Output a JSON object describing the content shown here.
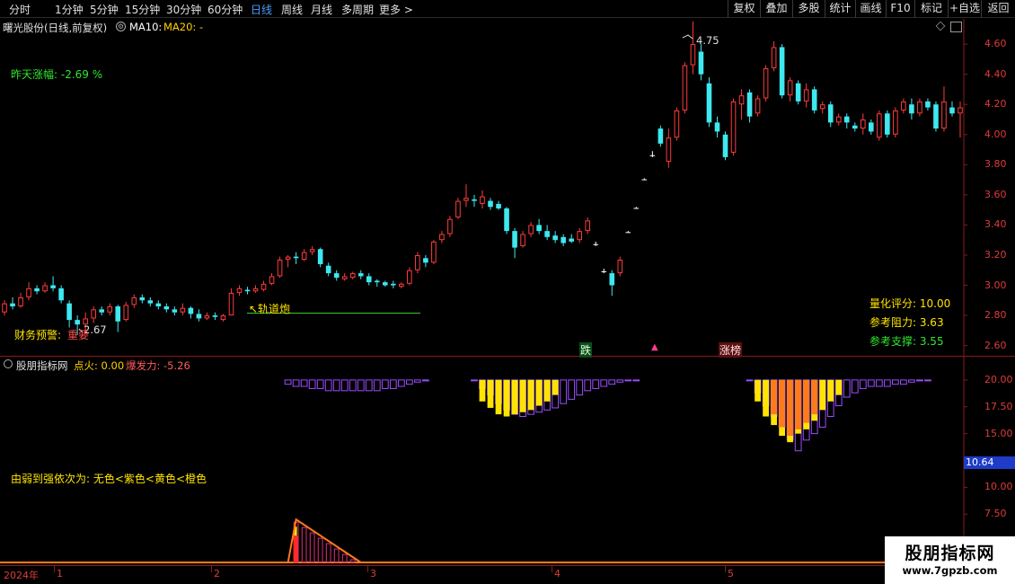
{
  "toolbar": {
    "left": [
      "分时",
      "1分钟",
      "5分钟",
      "15分钟",
      "30分钟",
      "60分钟",
      "日线",
      "周线",
      "月线",
      "多周期",
      "更多 >"
    ],
    "active": "日线",
    "right": [
      "复权",
      "叠加",
      "多股",
      "统计",
      "画线",
      "F10",
      "标记",
      "+自选",
      "返回"
    ]
  },
  "main": {
    "title": "曙光股份(日线,前复权)",
    "ma10": "MA10:",
    "ma20": "MA20: -",
    "yesterday_change_label": "昨天涨幅: -2.69 %",
    "high_label": "4.75",
    "low_label": "2.67",
    "annotation_track": "↖轨道炮",
    "finance_warning": "财务预警:",
    "finance_tag": "重要",
    "quant_score": "量化评分: 10.00",
    "resistance": "参考阻力: 3.63",
    "support": "参考支撑: 3.55",
    "marker_fall": "跌",
    "marker_up": "▲",
    "marker_limit": "涨榜",
    "y_axis": [
      "4.60",
      "4.40",
      "4.20",
      "4.00",
      "3.80",
      "3.60",
      "3.40",
      "3.20",
      "3.00",
      "2.80",
      "2.60"
    ]
  },
  "indicator": {
    "name": "股朋指标网",
    "ignite": "点火: 0.00",
    "burst": "爆发力: -5.26",
    "legend": "由弱到强依次为: 无色<紫色<黄色<橙色",
    "y_axis": [
      "20.00",
      "17.50",
      "15.00",
      "12.50",
      "10.00",
      "7.50",
      "5.00"
    ],
    "current_value": "10.64"
  },
  "dates": {
    "year": "2024年",
    "months": [
      "1",
      "2",
      "3",
      "4",
      "5"
    ]
  },
  "watermark": {
    "title": "股朋指标网",
    "url": "www.7gpzb.com"
  },
  "colors": {
    "up": "#ff3b3b",
    "down": "#3ee8f0",
    "axis": "#e03a3a",
    "active_tab": "#4b9bff",
    "purple": "#9a4dff",
    "yellow": "#ffe400",
    "orange": "#ff7a1a",
    "green_line": "#2ecc2e"
  },
  "chart_data": {
    "type": "candlestick",
    "ylim": [
      2.55,
      4.72
    ],
    "candles": [
      {
        "o": 2.82,
        "c": 2.88,
        "h": 2.9,
        "l": 2.8
      },
      {
        "o": 2.88,
        "c": 2.86,
        "h": 2.92,
        "l": 2.84
      },
      {
        "o": 2.86,
        "c": 2.92,
        "h": 2.95,
        "l": 2.85
      },
      {
        "o": 2.92,
        "c": 2.98,
        "h": 3.02,
        "l": 2.9
      },
      {
        "o": 2.98,
        "c": 2.96,
        "h": 3.0,
        "l": 2.94
      },
      {
        "o": 2.96,
        "c": 3.0,
        "h": 3.02,
        "l": 2.95
      },
      {
        "o": 3.0,
        "c": 2.98,
        "h": 3.06,
        "l": 2.96
      },
      {
        "o": 2.98,
        "c": 2.9,
        "h": 3.0,
        "l": 2.88
      },
      {
        "o": 2.88,
        "c": 2.77,
        "h": 2.9,
        "l": 2.72
      },
      {
        "o": 2.77,
        "c": 2.74,
        "h": 2.8,
        "l": 2.67
      },
      {
        "o": 2.74,
        "c": 2.78,
        "h": 2.82,
        "l": 2.7
      },
      {
        "o": 2.78,
        "c": 2.84,
        "h": 2.86,
        "l": 2.75
      },
      {
        "o": 2.84,
        "c": 2.82,
        "h": 2.86,
        "l": 2.8
      },
      {
        "o": 2.82,
        "c": 2.86,
        "h": 2.88,
        "l": 2.8
      },
      {
        "o": 2.86,
        "c": 2.76,
        "h": 2.87,
        "l": 2.69
      },
      {
        "o": 2.77,
        "c": 2.87,
        "h": 2.89,
        "l": 2.76
      },
      {
        "o": 2.87,
        "c": 2.92,
        "h": 2.94,
        "l": 2.85
      },
      {
        "o": 2.92,
        "c": 2.9,
        "h": 2.94,
        "l": 2.88
      },
      {
        "o": 2.9,
        "c": 2.88,
        "h": 2.92,
        "l": 2.86
      },
      {
        "o": 2.88,
        "c": 2.86,
        "h": 2.9,
        "l": 2.84
      },
      {
        "o": 2.86,
        "c": 2.84,
        "h": 2.88,
        "l": 2.82
      },
      {
        "o": 2.84,
        "c": 2.82,
        "h": 2.86,
        "l": 2.8
      },
      {
        "o": 2.82,
        "c": 2.85,
        "h": 2.88,
        "l": 2.8
      },
      {
        "o": 2.85,
        "c": 2.81,
        "h": 2.86,
        "l": 2.78
      },
      {
        "o": 2.81,
        "c": 2.78,
        "h": 2.84,
        "l": 2.76
      },
      {
        "o": 2.78,
        "c": 2.8,
        "h": 2.82,
        "l": 2.77
      },
      {
        "o": 2.8,
        "c": 2.79,
        "h": 2.82,
        "l": 2.77
      },
      {
        "o": 2.77,
        "c": 2.8,
        "h": 2.81,
        "l": 2.76
      },
      {
        "o": 2.8,
        "c": 2.95,
        "h": 2.98,
        "l": 2.8
      },
      {
        "o": 2.95,
        "c": 2.98,
        "h": 3.0,
        "l": 2.93
      },
      {
        "o": 2.97,
        "c": 2.96,
        "h": 2.99,
        "l": 2.94
      },
      {
        "o": 2.96,
        "c": 2.98,
        "h": 3.0,
        "l": 2.95
      },
      {
        "o": 2.97,
        "c": 3.01,
        "h": 3.03,
        "l": 2.96
      },
      {
        "o": 3.01,
        "c": 3.06,
        "h": 3.08,
        "l": 3.0
      },
      {
        "o": 3.06,
        "c": 3.17,
        "h": 3.19,
        "l": 3.05
      },
      {
        "o": 3.17,
        "c": 3.19,
        "h": 3.2,
        "l": 3.12
      },
      {
        "o": 3.19,
        "c": 3.18,
        "h": 3.22,
        "l": 3.14
      },
      {
        "o": 3.17,
        "c": 3.22,
        "h": 3.24,
        "l": 3.16
      },
      {
        "o": 3.22,
        "c": 3.24,
        "h": 3.26,
        "l": 3.2
      },
      {
        "o": 3.24,
        "c": 3.14,
        "h": 3.25,
        "l": 3.12
      },
      {
        "o": 3.13,
        "c": 3.08,
        "h": 3.15,
        "l": 3.06
      },
      {
        "o": 3.08,
        "c": 3.05,
        "h": 3.1,
        "l": 3.03
      },
      {
        "o": 3.04,
        "c": 3.06,
        "h": 3.08,
        "l": 3.03
      },
      {
        "o": 3.05,
        "c": 3.08,
        "h": 3.09,
        "l": 3.04
      },
      {
        "o": 3.08,
        "c": 3.06,
        "h": 3.1,
        "l": 3.04
      },
      {
        "o": 3.06,
        "c": 3.02,
        "h": 3.08,
        "l": 3.0
      },
      {
        "o": 3.03,
        "c": 3.02,
        "h": 3.04,
        "l": 2.99
      },
      {
        "o": 3.02,
        "c": 3.0,
        "h": 3.03,
        "l": 2.99
      },
      {
        "o": 3.01,
        "c": 3.0,
        "h": 3.03,
        "l": 2.98
      },
      {
        "o": 2.99,
        "c": 3.01,
        "h": 3.02,
        "l": 2.98
      },
      {
        "o": 3.01,
        "c": 3.1,
        "h": 3.12,
        "l": 3.0
      },
      {
        "o": 3.1,
        "c": 3.2,
        "h": 3.22,
        "l": 3.08
      },
      {
        "o": 3.18,
        "c": 3.15,
        "h": 3.2,
        "l": 3.12
      },
      {
        "o": 3.15,
        "c": 3.29,
        "h": 3.3,
        "l": 3.14
      },
      {
        "o": 3.3,
        "c": 3.34,
        "h": 3.36,
        "l": 3.28
      },
      {
        "o": 3.34,
        "c": 3.44,
        "h": 3.46,
        "l": 3.32
      },
      {
        "o": 3.45,
        "c": 3.56,
        "h": 3.58,
        "l": 3.44
      },
      {
        "o": 3.56,
        "c": 3.58,
        "h": 3.67,
        "l": 3.52
      },
      {
        "o": 3.57,
        "c": 3.56,
        "h": 3.6,
        "l": 3.52
      },
      {
        "o": 3.54,
        "c": 3.59,
        "h": 3.63,
        "l": 3.51
      },
      {
        "o": 3.56,
        "c": 3.52,
        "h": 3.58,
        "l": 3.5
      },
      {
        "o": 3.54,
        "c": 3.51,
        "h": 3.56,
        "l": 3.5
      },
      {
        "o": 3.51,
        "c": 3.36,
        "h": 3.52,
        "l": 3.34
      },
      {
        "o": 3.36,
        "c": 3.25,
        "h": 3.38,
        "l": 3.18
      },
      {
        "o": 3.26,
        "c": 3.34,
        "h": 3.36,
        "l": 3.25
      },
      {
        "o": 3.34,
        "c": 3.4,
        "h": 3.42,
        "l": 3.32
      },
      {
        "o": 3.4,
        "c": 3.36,
        "h": 3.44,
        "l": 3.34
      },
      {
        "o": 3.36,
        "c": 3.32,
        "h": 3.4,
        "l": 3.3
      },
      {
        "o": 3.33,
        "c": 3.3,
        "h": 3.36,
        "l": 3.28
      },
      {
        "o": 3.32,
        "c": 3.28,
        "h": 3.34,
        "l": 3.26
      },
      {
        "o": 3.31,
        "c": 3.29,
        "h": 3.34,
        "l": 3.28
      },
      {
        "o": 3.3,
        "c": 3.36,
        "h": 3.38,
        "l": 3.28
      },
      {
        "o": 3.36,
        "c": 3.43,
        "h": 3.45,
        "l": 3.34
      },
      {
        "o": 3.27,
        "c": 3.27,
        "h": 3.29,
        "l": 3.26
      },
      {
        "o": 3.09,
        "c": 3.09,
        "h": 3.11,
        "l": 3.08
      },
      {
        "o": 3.08,
        "c": 3.0,
        "h": 3.1,
        "l": 2.93
      },
      {
        "o": 3.08,
        "c": 3.17,
        "h": 3.19,
        "l": 3.06
      },
      {
        "o": 3.35,
        "c": 3.35,
        "h": 3.36,
        "l": 3.35
      },
      {
        "o": 3.51,
        "c": 3.51,
        "h": 3.52,
        "l": 3.51
      },
      {
        "o": 3.7,
        "c": 3.7,
        "h": 3.71,
        "l": 3.7
      },
      {
        "o": 3.86,
        "c": 3.86,
        "h": 3.89,
        "l": 3.85
      },
      {
        "o": 4.04,
        "c": 3.94,
        "h": 4.06,
        "l": 3.92
      },
      {
        "o": 3.82,
        "c": 3.98,
        "h": 4.04,
        "l": 3.78
      },
      {
        "o": 3.98,
        "c": 4.16,
        "h": 4.18,
        "l": 3.96
      },
      {
        "o": 4.16,
        "c": 4.46,
        "h": 4.48,
        "l": 4.14
      },
      {
        "o": 4.46,
        "c": 4.6,
        "h": 4.75,
        "l": 4.4
      },
      {
        "o": 4.55,
        "c": 4.4,
        "h": 4.6,
        "l": 4.36
      },
      {
        "o": 4.34,
        "c": 4.08,
        "h": 4.38,
        "l": 4.05
      },
      {
        "o": 4.08,
        "c": 4.02,
        "h": 4.12,
        "l": 3.98
      },
      {
        "o": 4.0,
        "c": 3.85,
        "h": 4.02,
        "l": 3.83
      },
      {
        "o": 3.88,
        "c": 4.22,
        "h": 4.24,
        "l": 3.86
      },
      {
        "o": 4.2,
        "c": 4.26,
        "h": 4.3,
        "l": 4.1
      },
      {
        "o": 4.28,
        "c": 4.12,
        "h": 4.3,
        "l": 4.08
      },
      {
        "o": 4.14,
        "c": 4.24,
        "h": 4.26,
        "l": 4.12
      },
      {
        "o": 4.24,
        "c": 4.44,
        "h": 4.46,
        "l": 4.22
      },
      {
        "o": 4.44,
        "c": 4.58,
        "h": 4.62,
        "l": 4.42
      },
      {
        "o": 4.58,
        "c": 4.26,
        "h": 4.6,
        "l": 4.24
      },
      {
        "o": 4.26,
        "c": 4.36,
        "h": 4.38,
        "l": 4.22
      },
      {
        "o": 4.34,
        "c": 4.22,
        "h": 4.36,
        "l": 4.2
      },
      {
        "o": 4.22,
        "c": 4.3,
        "h": 4.34,
        "l": 4.18
      },
      {
        "o": 4.3,
        "c": 4.16,
        "h": 4.32,
        "l": 4.14
      },
      {
        "o": 4.17,
        "c": 4.2,
        "h": 4.22,
        "l": 4.14
      },
      {
        "o": 4.2,
        "c": 4.08,
        "h": 4.22,
        "l": 4.05
      },
      {
        "o": 4.08,
        "c": 4.12,
        "h": 4.14,
        "l": 4.06
      },
      {
        "o": 4.12,
        "c": 4.08,
        "h": 4.14,
        "l": 4.04
      },
      {
        "o": 4.06,
        "c": 4.04,
        "h": 4.08,
        "l": 4.02
      },
      {
        "o": 4.04,
        "c": 4.1,
        "h": 4.14,
        "l": 4.0
      },
      {
        "o": 4.08,
        "c": 4.02,
        "h": 4.1,
        "l": 4.0
      },
      {
        "o": 3.98,
        "c": 4.14,
        "h": 4.16,
        "l": 3.96
      },
      {
        "o": 4.14,
        "c": 4.0,
        "h": 4.16,
        "l": 3.98
      },
      {
        "o": 4.0,
        "c": 4.16,
        "h": 4.18,
        "l": 3.98
      },
      {
        "o": 4.16,
        "c": 4.22,
        "h": 4.24,
        "l": 4.14
      },
      {
        "o": 4.2,
        "c": 4.14,
        "h": 4.24,
        "l": 4.1
      },
      {
        "o": 4.14,
        "c": 4.22,
        "h": 4.24,
        "l": 4.12
      },
      {
        "o": 4.22,
        "c": 4.18,
        "h": 4.24,
        "l": 4.16
      },
      {
        "o": 4.2,
        "c": 4.04,
        "h": 4.22,
        "l": 4.02
      },
      {
        "o": 4.04,
        "c": 4.22,
        "h": 4.32,
        "l": 4.02
      },
      {
        "o": 4.18,
        "c": 4.14,
        "h": 4.22,
        "l": 4.12
      },
      {
        "o": 4.14,
        "c": 4.18,
        "h": 4.22,
        "l": 3.98
      }
    ],
    "indicator_ylim": [
      3.0,
      22.0
    ],
    "purple_zones": [
      {
        "from": 35,
        "to": 52,
        "depth": [
          19.6,
          19.4,
          19.4,
          19.2,
          19.2,
          19.0,
          19.0,
          19.0,
          19.0,
          19.0,
          19.0,
          19.0,
          19.2,
          19.2,
          19.4,
          19.6,
          19.8,
          20.0
        ]
      },
      {
        "from": 58,
        "to": 78,
        "depth": [
          20.0,
          19.2,
          18.6,
          17.8,
          17.2,
          16.8,
          16.6,
          16.8,
          17.0,
          17.2,
          17.4,
          17.8,
          18.2,
          18.6,
          19.0,
          19.2,
          19.4,
          19.6,
          19.8,
          20.0,
          20.0
        ]
      },
      {
        "from": 92,
        "to": 114,
        "depth": [
          20.0,
          18.8,
          17.6,
          16.6,
          15.6,
          14.4,
          13.4,
          14.4,
          15.0,
          15.6,
          16.6,
          17.6,
          18.4,
          18.8,
          19.2,
          19.4,
          19.4,
          19.4,
          19.6,
          19.6,
          19.8,
          20.0,
          20.0
        ]
      }
    ],
    "yellow_zones": [
      {
        "from": 59,
        "to": 68,
        "depth": [
          18.0,
          17.4,
          16.8,
          16.6,
          16.8,
          17.0,
          17.2,
          17.6,
          18.0,
          18.6
        ]
      },
      {
        "from": 93,
        "to": 103,
        "depth": [
          18.0,
          16.6,
          15.8,
          14.8,
          14.2,
          15.0,
          15.4,
          16.2,
          17.2,
          18.0,
          18.6
        ]
      }
    ],
    "orange_zones": [
      {
        "from": 95,
        "to": 100,
        "depth": [
          16.8,
          15.6,
          14.8,
          15.4,
          16.0,
          16.8
        ]
      }
    ],
    "spike": {
      "start": 35,
      "peak": 36,
      "end": 44,
      "peak_value": 7.0,
      "base": 3.0
    }
  }
}
